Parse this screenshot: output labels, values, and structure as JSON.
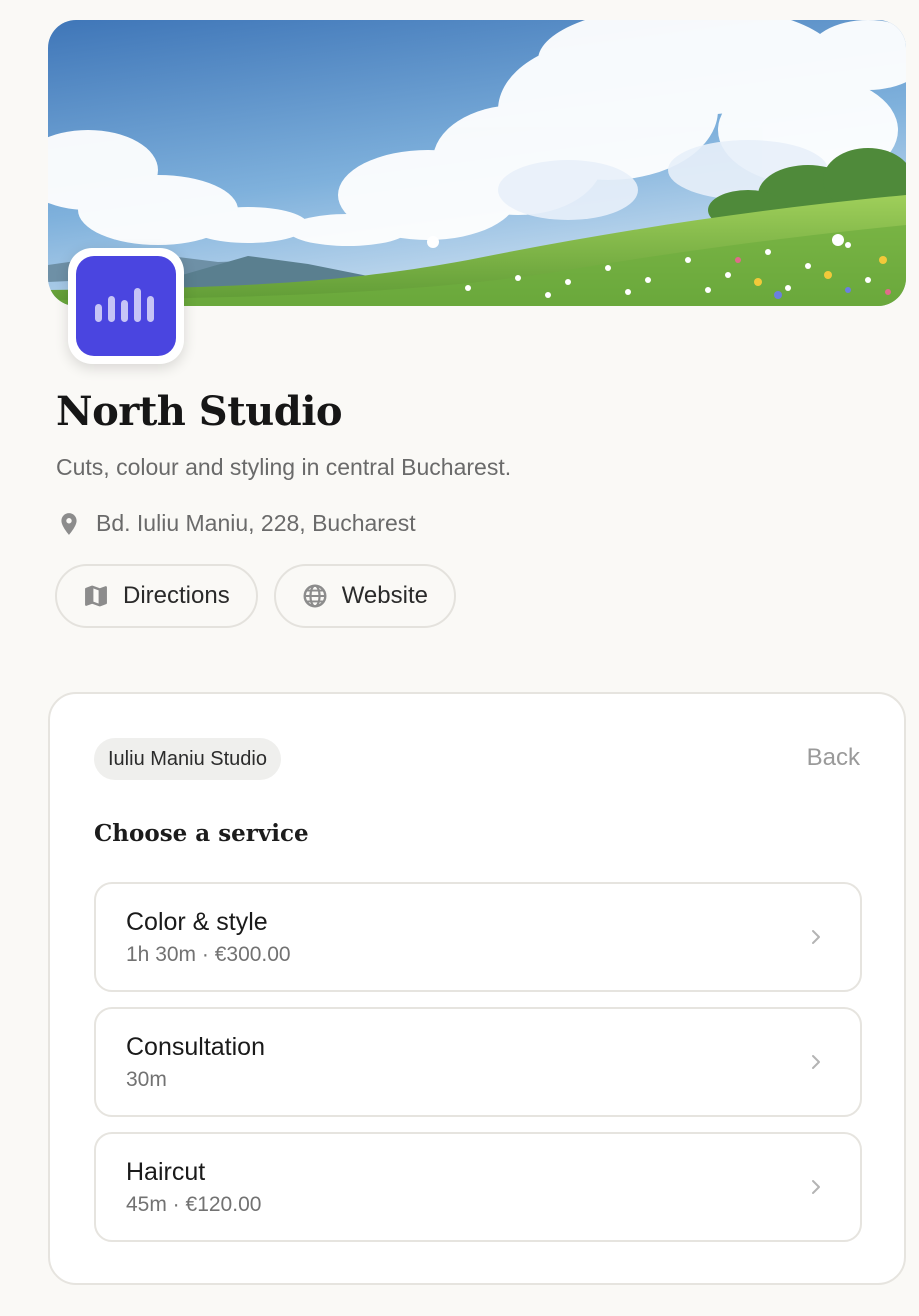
{
  "business": {
    "name": "North Studio",
    "tagline": "Cuts, colour and styling in central Bucharest.",
    "address": "Bd. Iuliu Maniu, 228, Bucharest"
  },
  "actions": {
    "directions_label": "Directions",
    "website_label": "Website"
  },
  "booking": {
    "location_chip": "Iuliu Maniu Studio",
    "back_label": "Back",
    "section_title": "Choose a service",
    "services": [
      {
        "name": "Color & style",
        "meta": "1h 30m · €300.00"
      },
      {
        "name": "Consultation",
        "meta": "30m"
      },
      {
        "name": "Haircut",
        "meta": "45m · €120.00"
      }
    ]
  },
  "icons": {
    "logo": "audio-bars-icon",
    "address": "map-pin-icon",
    "directions": "map-icon",
    "website": "globe-icon",
    "service_arrow": "chevron-right-icon"
  },
  "colors": {
    "brand": "#4a45e0",
    "background": "#faf9f6",
    "muted_text": "#6a6a6a"
  }
}
